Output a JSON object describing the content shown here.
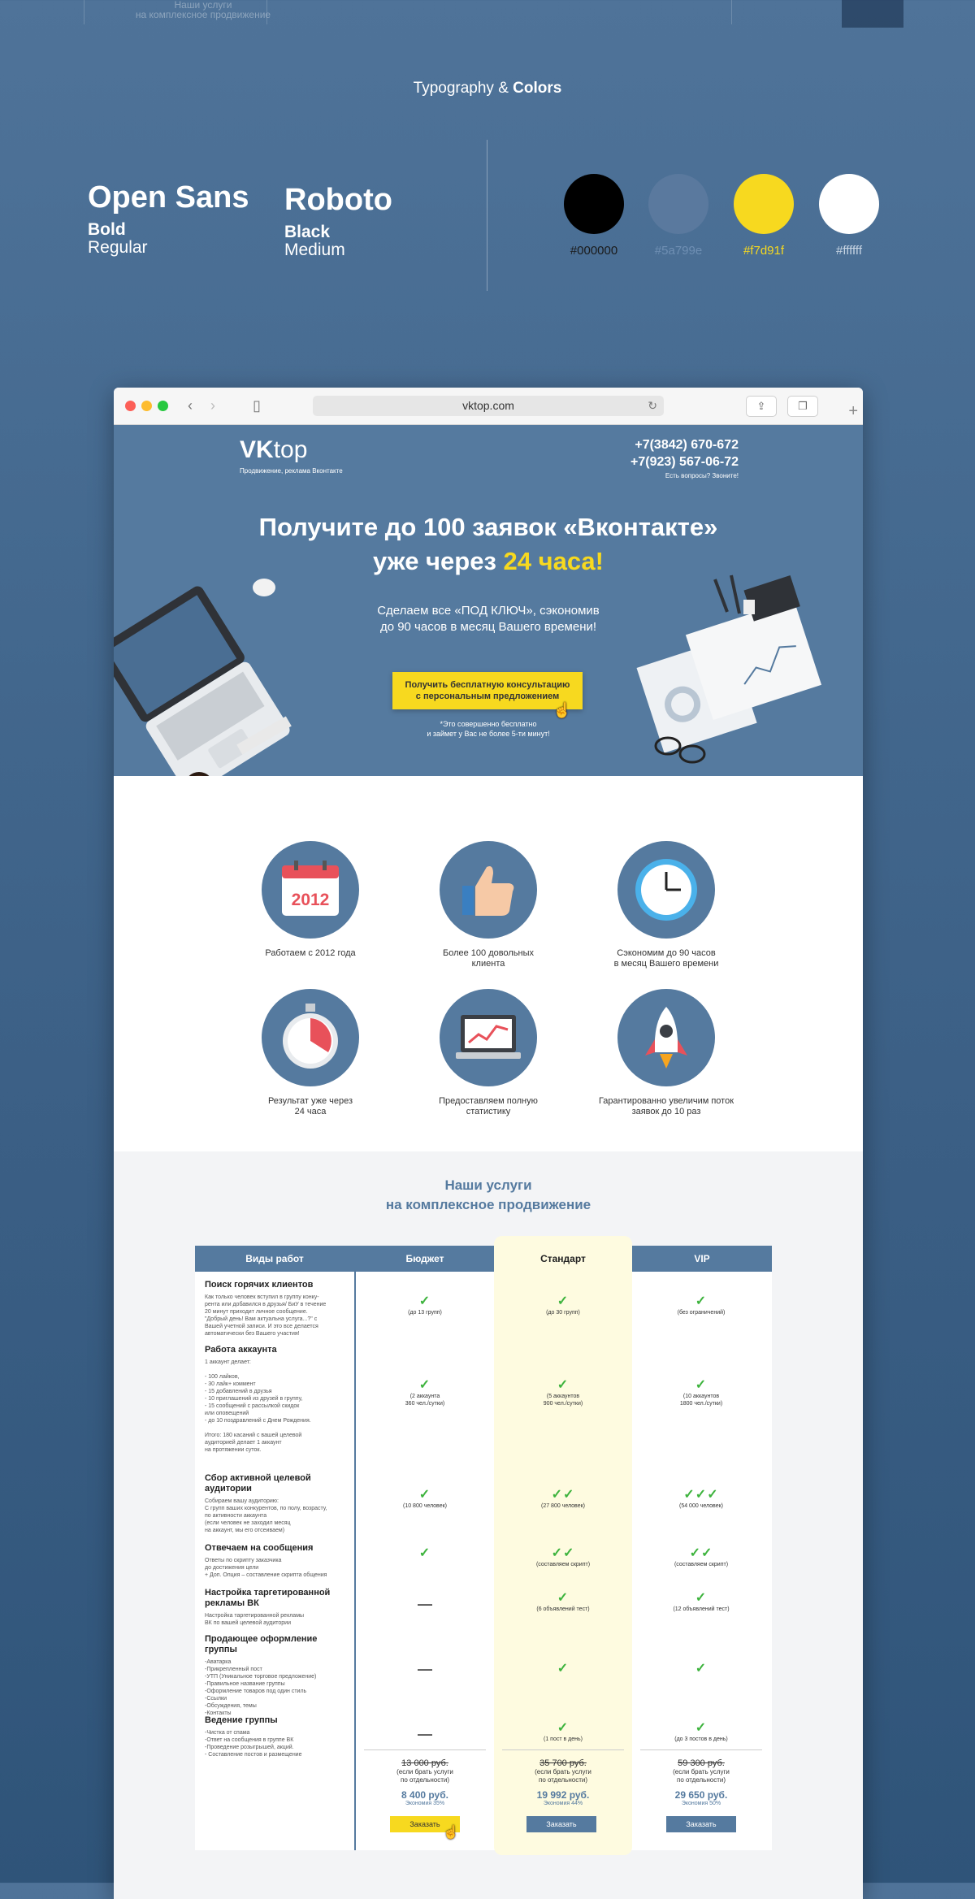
{
  "top_strip": {
    "services_ghost_1": "Наши услуги",
    "services_ghost_2": "на комплексное продвижение"
  },
  "typography": {
    "title_prefix": "Typography &",
    "title_bold": "Colors",
    "fonts": [
      {
        "name": "Open Sans",
        "weight1": "Bold",
        "weight2": "Regular"
      },
      {
        "name": "Roboto",
        "weight1": "Black",
        "weight2": "Medium"
      }
    ],
    "colors": [
      {
        "hex": "#000000",
        "label": "#000000",
        "label_color": "#1a1a1a"
      },
      {
        "hex": "#5a799e",
        "label": "#5a799e",
        "label_color": "#6f8fb3"
      },
      {
        "hex": "#f7d91f",
        "label": "#f7d91f",
        "label_color": "#f7d91f"
      },
      {
        "hex": "#ffffff",
        "label": "#ffffff",
        "label_color": "#c9d6e4"
      }
    ]
  },
  "browser": {
    "url": "vktop.com",
    "back_icon": "‹",
    "forward_icon": "›",
    "sidebar_icon": "▯",
    "reload_icon": "↻",
    "share_icon": "⇪",
    "tabs_icon": "❐",
    "new_tab_icon": "+"
  },
  "site": {
    "logo_bold": "VK",
    "logo_regular": "top",
    "logo_sub": "Продвижение, реклама Вконтакте",
    "phone1": "+7(3842) 670-672",
    "phone2": "+7(923) 567-06-72",
    "phone_question": "Есть вопросы? Звоните!",
    "headline_line1": "Получите до 100 заявок «Вконтакте»",
    "headline_line2_prefix": "уже через ",
    "headline_accent": "24 часа!",
    "subtitle_line1": "Сделаем все «ПОД КЛЮЧ», сэкономив",
    "subtitle_line2": "до 90 часов в месяц Вашего времени!",
    "cta_line1": "Получить бесплатную консультацию",
    "cta_line2": "с персональным предложением",
    "note_line1": "*Это совершенно бесплатно",
    "note_line2": "и займет у Вас не более 5-ти минут!",
    "calendar_year": "2012"
  },
  "features": [
    {
      "icon": "calendar-icon",
      "label": "Работаем с 2012 года"
    },
    {
      "icon": "thumbs-up-icon",
      "label": "Более 100 довольных\nклиента"
    },
    {
      "icon": "clock-icon",
      "label": "Сэкономим до 90 часов\nв месяц Вашего времени"
    },
    {
      "icon": "stopwatch-icon",
      "label": "Результат уже через\n24 часа"
    },
    {
      "icon": "laptop-chart-icon",
      "label": "Предоставляем полную\nстатистику"
    },
    {
      "icon": "rocket-icon",
      "label": "Гарантированно увеличим поток\nзаявок до 10 раз"
    }
  ],
  "services": {
    "title_line1": "Наши услуги",
    "title_line2": "на комплексное продвижение",
    "headers": [
      "Виды работ",
      "Бюджет",
      "Стандарт",
      "VIP"
    ],
    "rows": [
      {
        "title": "Поиск горячих клиентов",
        "desc": "Как только человек вступил в группу конку-\nрента или добавился в друзья/ БиУ в течение\n20 минут приходит личное сообщение.\n\"Добрый день! Вам актуальна услуга...?\" с\nВашей учетной записи. И это все делается\nавтоматически без Вашего участия!",
        "budget": {
          "checks": "✓",
          "note": "(до 13 групп)"
        },
        "standard": {
          "checks": "✓",
          "note": "(до 30 групп)"
        },
        "vip": {
          "checks": "✓",
          "note": "(без ограничений)"
        }
      },
      {
        "title": "Работа аккаунта",
        "desc": "1 аккаунт делает:\n\n- 100 лайков,\n- 30 лайк+ коммент\n- 15 добавлений в друзья\n- 10 приглашений из друзей в группу,\n- 15 сообщений с рассылкой скидок\nили оповещений\n- до 10 поздравлений с Днем Рождения.\n\nИтого: 180 касаний с вашей целевой\nаудиторией делает 1 аккаунт\nна протяжении суток.",
        "budget": {
          "checks": "✓",
          "note": "(2 аккаунта\n360 чел./сутки)"
        },
        "standard": {
          "checks": "✓",
          "note": "(5 аккаунтов\n900 чел./сутки)"
        },
        "vip": {
          "checks": "✓",
          "note": "(10 аккаунтов\n1800 чел./сутки)"
        }
      },
      {
        "title": "Сбор активной целевой\nаудитории",
        "desc": "Собираем вашу аудиторию:\nС групп ваших конкурентов, по полу, возрасту,\nпо активности аккаунта\n(если человек не заходил месяц\nна аккаунт, мы его отсеиваем)",
        "budget": {
          "checks": "✓",
          "note": "(10 800 человек)"
        },
        "standard": {
          "checks": "✓✓",
          "note": "(27 800 человек)"
        },
        "vip": {
          "checks": "✓✓✓",
          "note": "(54 000 человек)"
        }
      },
      {
        "title": "Отвечаем на сообщения",
        "desc": "Ответы по скрипту заказчика\nдо достижения цели\n+ Доп. Опция – составление скрипта общения",
        "budget": {
          "checks": "✓",
          "note": ""
        },
        "standard": {
          "checks": "✓✓",
          "note": "(составляем скрипт)"
        },
        "vip": {
          "checks": "✓✓",
          "note": "(составляем скрипт)"
        }
      },
      {
        "title": "Настройка таргетированной\nрекламы ВК",
        "desc": "Настройка таргетированной рекламы\nВК по вашей целевой аудитории",
        "budget": {
          "dash": "—"
        },
        "standard": {
          "checks": "✓",
          "note": "(6 объявлений тест)"
        },
        "vip": {
          "checks": "✓",
          "note": "(12 объявлений тест)"
        }
      },
      {
        "title": "Продающее оформление группы",
        "desc": "-Аватарка\n-Прикрепленный пост\n-УТП (Уникальное торговое предложение)\n-Правильное название группы\n-Оформление товаров под один стиль\n-Ссылки\n-Обсуждения, темы\n-Контакты",
        "budget": {
          "dash": "—"
        },
        "standard": {
          "checks": "✓",
          "note": ""
        },
        "vip": {
          "checks": "✓",
          "note": ""
        }
      },
      {
        "title": "Ведение группы",
        "desc": "-Чистка от спама\n-Ответ на сообщения в группе ВК\n-Проведение розыгрышей, акций.\n- Составление постов и размещение",
        "budget": {
          "dash": "—"
        },
        "standard": {
          "checks": "✓",
          "note": "(1 пост в день)"
        },
        "vip": {
          "checks": "✓",
          "note": "(до 3 постов в день)"
        }
      }
    ],
    "prices": [
      {
        "old": "13 000 руб.",
        "ind": "(если брать услуги\nпо отдельности)",
        "new": "8 400 руб.",
        "eco": "Экономия 35%",
        "btn": "Заказать"
      },
      {
        "old": "35 700 руб.",
        "ind": "(если брать услуги\nпо отдельности)",
        "new": "19 992 руб.",
        "eco": "Экономия 44%",
        "btn": "Заказать"
      },
      {
        "old": "59 300 руб.",
        "ind": "(если брать услуги\nпо отдельности)",
        "new": "29 650 руб.",
        "eco": "Экономия 50%",
        "btn": "Заказать"
      }
    ]
  }
}
